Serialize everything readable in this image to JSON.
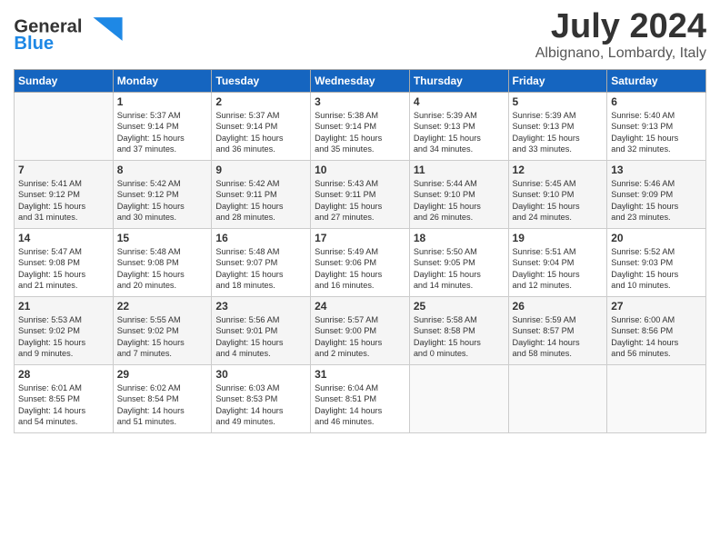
{
  "header": {
    "logo_general": "General",
    "logo_blue": "Blue",
    "month": "July 2024",
    "location": "Albignano, Lombardy, Italy"
  },
  "weekdays": [
    "Sunday",
    "Monday",
    "Tuesday",
    "Wednesday",
    "Thursday",
    "Friday",
    "Saturday"
  ],
  "weeks": [
    [
      {
        "day": "",
        "info": ""
      },
      {
        "day": "1",
        "info": "Sunrise: 5:37 AM\nSunset: 9:14 PM\nDaylight: 15 hours\nand 37 minutes."
      },
      {
        "day": "2",
        "info": "Sunrise: 5:37 AM\nSunset: 9:14 PM\nDaylight: 15 hours\nand 36 minutes."
      },
      {
        "day": "3",
        "info": "Sunrise: 5:38 AM\nSunset: 9:14 PM\nDaylight: 15 hours\nand 35 minutes."
      },
      {
        "day": "4",
        "info": "Sunrise: 5:39 AM\nSunset: 9:13 PM\nDaylight: 15 hours\nand 34 minutes."
      },
      {
        "day": "5",
        "info": "Sunrise: 5:39 AM\nSunset: 9:13 PM\nDaylight: 15 hours\nand 33 minutes."
      },
      {
        "day": "6",
        "info": "Sunrise: 5:40 AM\nSunset: 9:13 PM\nDaylight: 15 hours\nand 32 minutes."
      }
    ],
    [
      {
        "day": "7",
        "info": "Sunrise: 5:41 AM\nSunset: 9:12 PM\nDaylight: 15 hours\nand 31 minutes."
      },
      {
        "day": "8",
        "info": "Sunrise: 5:42 AM\nSunset: 9:12 PM\nDaylight: 15 hours\nand 30 minutes."
      },
      {
        "day": "9",
        "info": "Sunrise: 5:42 AM\nSunset: 9:11 PM\nDaylight: 15 hours\nand 28 minutes."
      },
      {
        "day": "10",
        "info": "Sunrise: 5:43 AM\nSunset: 9:11 PM\nDaylight: 15 hours\nand 27 minutes."
      },
      {
        "day": "11",
        "info": "Sunrise: 5:44 AM\nSunset: 9:10 PM\nDaylight: 15 hours\nand 26 minutes."
      },
      {
        "day": "12",
        "info": "Sunrise: 5:45 AM\nSunset: 9:10 PM\nDaylight: 15 hours\nand 24 minutes."
      },
      {
        "day": "13",
        "info": "Sunrise: 5:46 AM\nSunset: 9:09 PM\nDaylight: 15 hours\nand 23 minutes."
      }
    ],
    [
      {
        "day": "14",
        "info": "Sunrise: 5:47 AM\nSunset: 9:08 PM\nDaylight: 15 hours\nand 21 minutes."
      },
      {
        "day": "15",
        "info": "Sunrise: 5:48 AM\nSunset: 9:08 PM\nDaylight: 15 hours\nand 20 minutes."
      },
      {
        "day": "16",
        "info": "Sunrise: 5:48 AM\nSunset: 9:07 PM\nDaylight: 15 hours\nand 18 minutes."
      },
      {
        "day": "17",
        "info": "Sunrise: 5:49 AM\nSunset: 9:06 PM\nDaylight: 15 hours\nand 16 minutes."
      },
      {
        "day": "18",
        "info": "Sunrise: 5:50 AM\nSunset: 9:05 PM\nDaylight: 15 hours\nand 14 minutes."
      },
      {
        "day": "19",
        "info": "Sunrise: 5:51 AM\nSunset: 9:04 PM\nDaylight: 15 hours\nand 12 minutes."
      },
      {
        "day": "20",
        "info": "Sunrise: 5:52 AM\nSunset: 9:03 PM\nDaylight: 15 hours\nand 10 minutes."
      }
    ],
    [
      {
        "day": "21",
        "info": "Sunrise: 5:53 AM\nSunset: 9:02 PM\nDaylight: 15 hours\nand 9 minutes."
      },
      {
        "day": "22",
        "info": "Sunrise: 5:55 AM\nSunset: 9:02 PM\nDaylight: 15 hours\nand 7 minutes."
      },
      {
        "day": "23",
        "info": "Sunrise: 5:56 AM\nSunset: 9:01 PM\nDaylight: 15 hours\nand 4 minutes."
      },
      {
        "day": "24",
        "info": "Sunrise: 5:57 AM\nSunset: 9:00 PM\nDaylight: 15 hours\nand 2 minutes."
      },
      {
        "day": "25",
        "info": "Sunrise: 5:58 AM\nSunset: 8:58 PM\nDaylight: 15 hours\nand 0 minutes."
      },
      {
        "day": "26",
        "info": "Sunrise: 5:59 AM\nSunset: 8:57 PM\nDaylight: 14 hours\nand 58 minutes."
      },
      {
        "day": "27",
        "info": "Sunrise: 6:00 AM\nSunset: 8:56 PM\nDaylight: 14 hours\nand 56 minutes."
      }
    ],
    [
      {
        "day": "28",
        "info": "Sunrise: 6:01 AM\nSunset: 8:55 PM\nDaylight: 14 hours\nand 54 minutes."
      },
      {
        "day": "29",
        "info": "Sunrise: 6:02 AM\nSunset: 8:54 PM\nDaylight: 14 hours\nand 51 minutes."
      },
      {
        "day": "30",
        "info": "Sunrise: 6:03 AM\nSunset: 8:53 PM\nDaylight: 14 hours\nand 49 minutes."
      },
      {
        "day": "31",
        "info": "Sunrise: 6:04 AM\nSunset: 8:51 PM\nDaylight: 14 hours\nand 46 minutes."
      },
      {
        "day": "",
        "info": ""
      },
      {
        "day": "",
        "info": ""
      },
      {
        "day": "",
        "info": ""
      }
    ]
  ]
}
